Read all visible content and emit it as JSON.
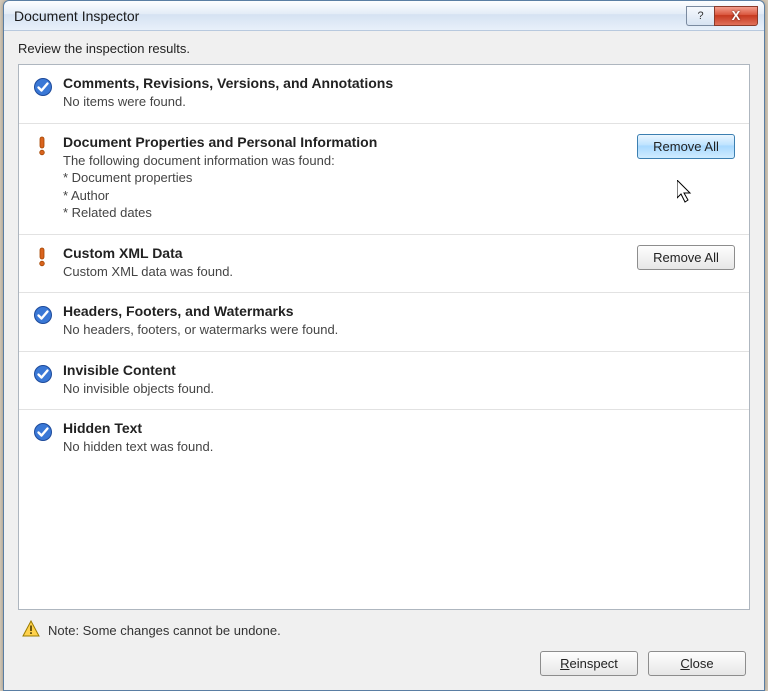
{
  "window": {
    "title": "Document Inspector",
    "help_symbol": "?",
    "close_symbol": "X"
  },
  "instruction": "Review the inspection results.",
  "sections": [
    {
      "status": "ok",
      "title": "Comments, Revisions, Versions, and Annotations",
      "body": "No items were found.",
      "action": null
    },
    {
      "status": "warn",
      "title": "Document Properties and Personal Information",
      "body": "The following document information was found:\n* Document properties\n* Author\n* Related dates",
      "action": "Remove All",
      "action_hover": true
    },
    {
      "status": "warn",
      "title": "Custom XML Data",
      "body": "Custom XML data was found.",
      "action": "Remove All",
      "action_hover": false
    },
    {
      "status": "ok",
      "title": "Headers, Footers, and Watermarks",
      "body": "No headers, footers, or watermarks were found.",
      "action": null
    },
    {
      "status": "ok",
      "title": "Invisible Content",
      "body": "No invisible objects found.",
      "action": null
    },
    {
      "status": "ok",
      "title": "Hidden Text",
      "body": "No hidden text was found.",
      "action": null
    }
  ],
  "footer": {
    "note": "Note: Some changes cannot be undone.",
    "reinspect": "Reinspect",
    "close": "Close"
  }
}
